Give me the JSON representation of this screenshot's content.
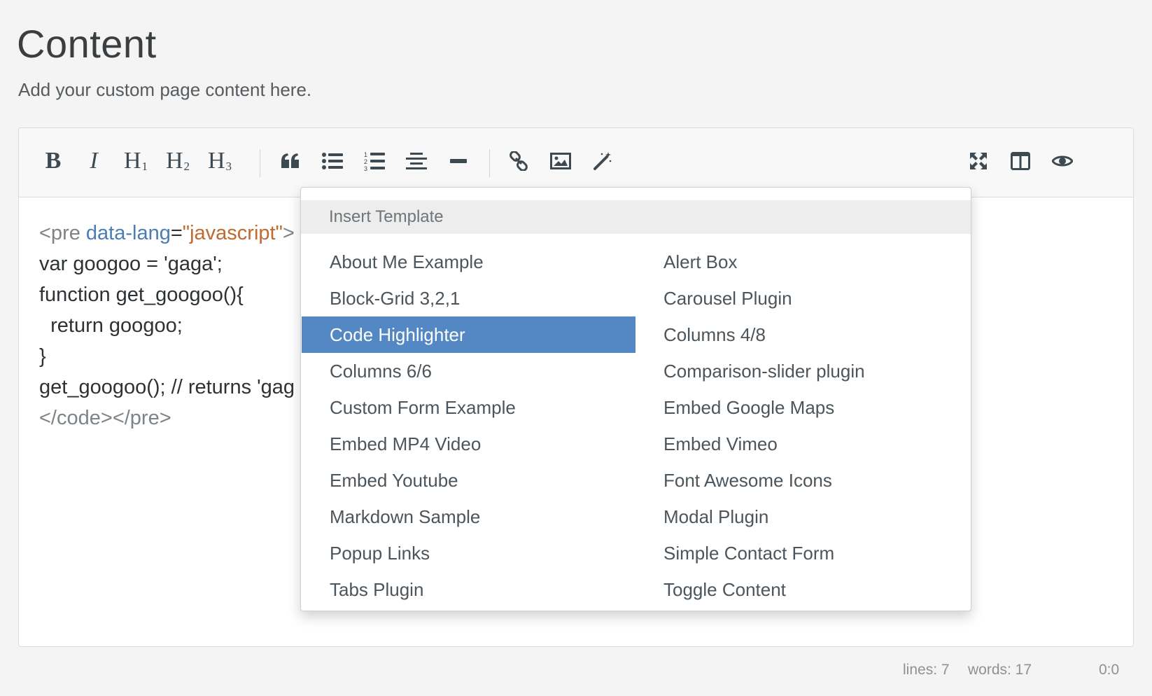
{
  "header": {
    "title": "Content",
    "subtitle": "Add your custom page content here."
  },
  "toolbar": {
    "bold_label": "B",
    "italic_label": "I",
    "h1_label": "H",
    "h1_sub": "1",
    "h2_label": "H",
    "h2_sub": "2",
    "h3_label": "H",
    "h3_sub": "3",
    "icons": [
      "quote-icon",
      "unordered-list-icon",
      "ordered-list-icon",
      "align-center-icon",
      "horizontal-rule-icon",
      "link-icon",
      "image-icon",
      "magic-wand-icon",
      "fullscreen-icon",
      "side-by-side-icon",
      "preview-eye-icon"
    ]
  },
  "editor": {
    "line1_tag_open": "<pre ",
    "line1_attr": "data-lang",
    "line1_eq": "=",
    "line1_str": "\"javascript\"",
    "line1_rest": ">",
    "line2": "var googoo = 'gaga';",
    "line3": "function get_googoo(){",
    "line4": "  return googoo;",
    "line5": "}",
    "line6": "get_googoo(); // returns 'gag",
    "line7": "</code></pre>"
  },
  "dropdown": {
    "header": "Insert Template",
    "selected": "Code Highlighter",
    "left_items": [
      "About Me Example",
      "Block-Grid 3,2,1",
      "Code Highlighter",
      "Columns 6/6",
      "Custom Form Example",
      "Embed MP4 Video",
      "Embed Youtube",
      "Markdown Sample",
      "Popup Links",
      "Tabs Plugin"
    ],
    "right_items": [
      "Alert Box",
      "Carousel Plugin",
      "Columns 4/8",
      "Comparison-slider plugin",
      "Embed Google Maps",
      "Embed Vimeo",
      "Font Awesome Icons",
      "Modal Plugin",
      "Simple Contact Form",
      "Toggle Content"
    ]
  },
  "status": {
    "lines": "lines: 7",
    "words": "words: 17",
    "cursor": "0:0"
  },
  "colors": {
    "accent": "#5388c5",
    "attr": "#4a7db5",
    "string": "#c06a2f"
  }
}
